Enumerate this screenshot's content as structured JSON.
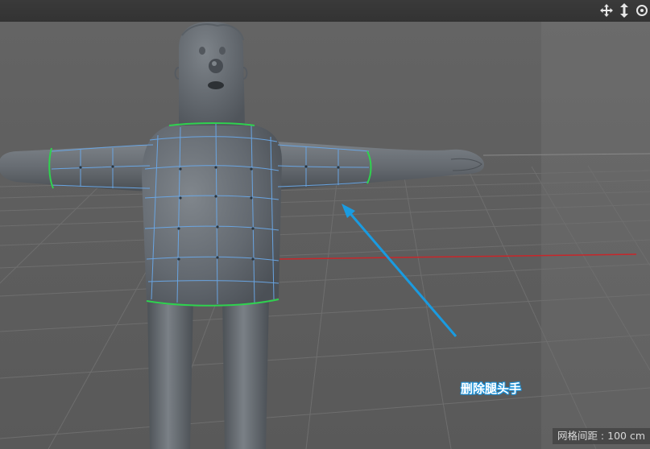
{
  "viewport": {
    "nav_icons": [
      "move-icon",
      "move-vertical-icon",
      "orbit-icon"
    ],
    "annotation_text": "删除腿头手",
    "grid_spacing_label": "网格间距 : 100 cm"
  },
  "colors": {
    "viewport_bg": "#5e5e5e",
    "mesh_body": "#6b7076",
    "edge_loop_selected": "#2fd24f",
    "mesh_lines": "#6aa8e8",
    "annotation_arrow": "#1a9be0",
    "x_axis": "#c8262a"
  }
}
